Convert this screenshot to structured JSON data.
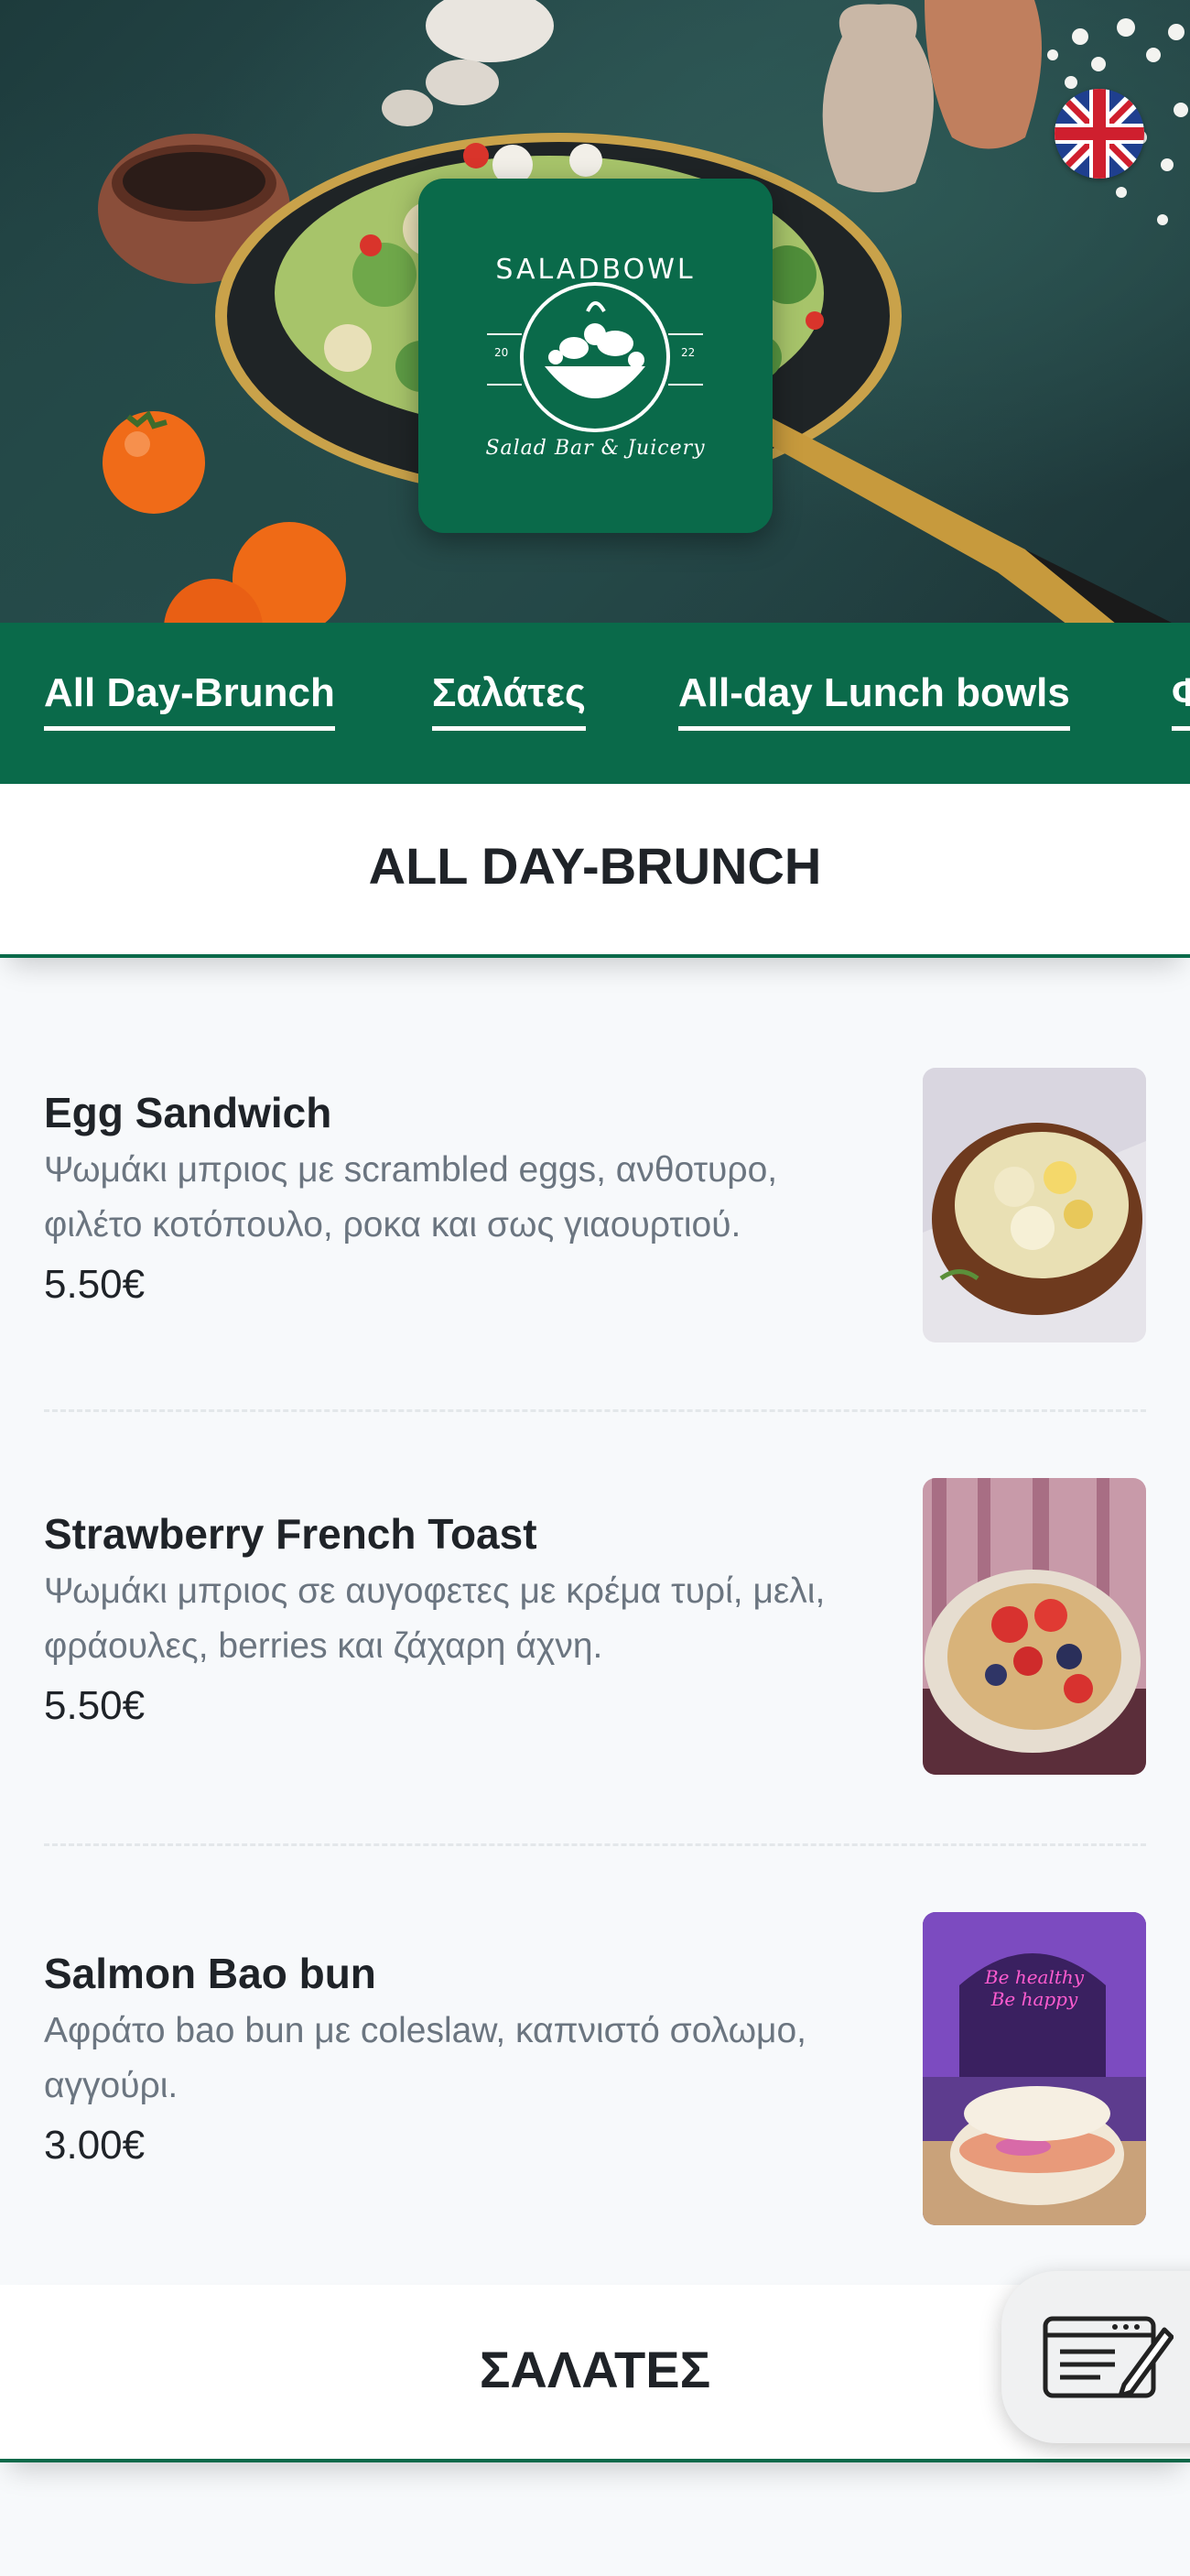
{
  "brand": {
    "name": "SALADBOWL",
    "tagline": "Salad Bar & Juicery",
    "year_left": "20",
    "year_right": "22",
    "color": "#0a6a4a"
  },
  "language_flag": "uk-flag-icon",
  "categories": [
    {
      "label": "All Day-Brunch"
    },
    {
      "label": "Σαλάτες"
    },
    {
      "label": "All-day Lunch bowls"
    },
    {
      "label": "Φ"
    }
  ],
  "sections": [
    {
      "title": "ALL DAY-BRUNCH",
      "items": [
        {
          "name": "Egg Sandwich",
          "description": "Ψωμάκι μπριος με scrambled eggs, ανθοτυρο, φιλέτο κοτόπουλο, ροκα και σως γιαουρτιού.",
          "price": "5.50€"
        },
        {
          "name": "Strawberry French Toast",
          "description": "Ψωμάκι μπριος σε αυγοφετες με κρέμα τυρί, μελι, φράουλες, berries και ζάχαρη άχνη.",
          "price": "5.50€"
        },
        {
          "name": "Salmon Bao bun",
          "description": "Αφράτο bao bun με coleslaw, καπνιστό σολωμο, αγγούρι.",
          "price": "3.00€"
        }
      ]
    },
    {
      "title": "ΣΑΛΑΤΕΣ"
    }
  ],
  "photo_neon_text": "Be healthy Be happy",
  "floating_button": "menu-notepad-icon"
}
